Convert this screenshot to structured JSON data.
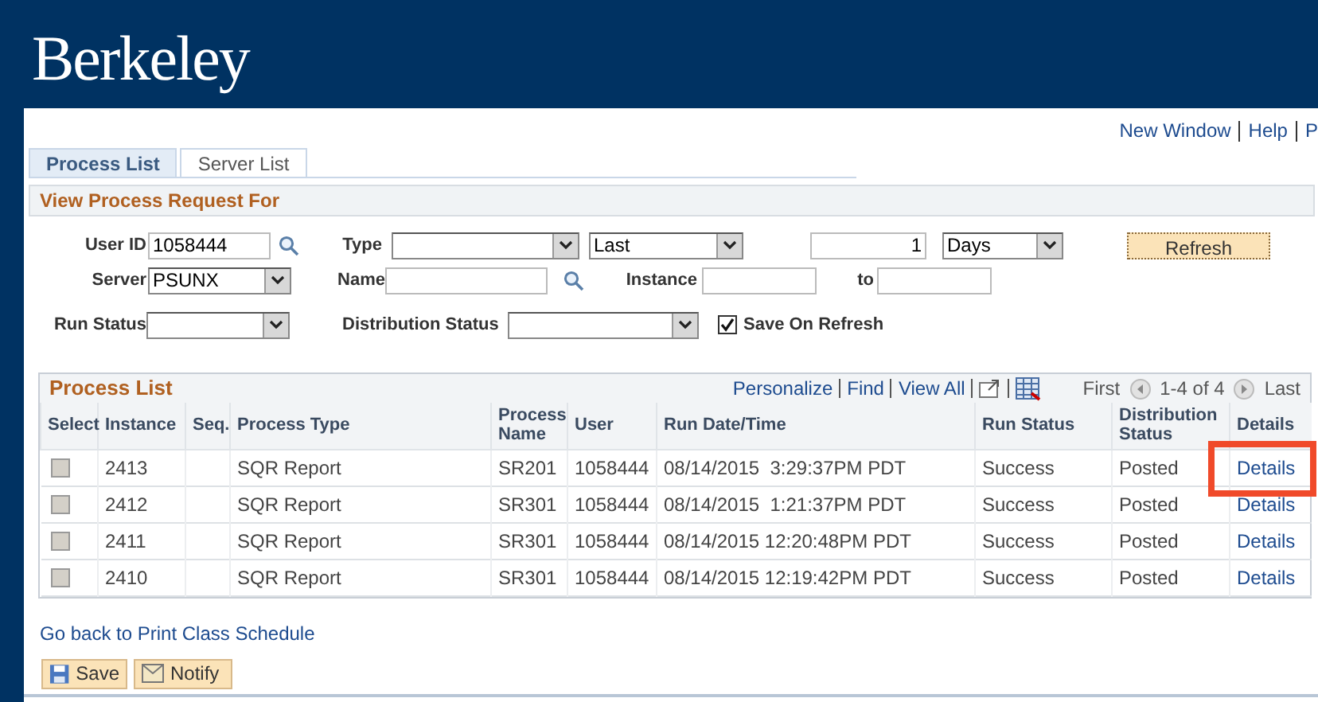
{
  "header": {
    "logo": "Berkeley"
  },
  "top_links": [
    "New Window",
    "Help",
    "P"
  ],
  "tabs": [
    {
      "label": "Process List",
      "selected": true
    },
    {
      "label": "Server List",
      "selected": false
    }
  ],
  "filter": {
    "title": "View Process Request For",
    "user_id": {
      "label": "User ID",
      "value": "1058444"
    },
    "type": {
      "label": "Type"
    },
    "last": {
      "value": "Last"
    },
    "count": {
      "value": "1"
    },
    "unit": {
      "value": "Days"
    },
    "refresh": "Refresh",
    "server": {
      "label": "Server",
      "value": "PSUNX"
    },
    "name": {
      "label": "Name"
    },
    "instance": {
      "label": "Instance"
    },
    "to": {
      "label": "to"
    },
    "run_status": {
      "label": "Run Status"
    },
    "distribution_status": {
      "label": "Distribution Status"
    },
    "save_on_refresh": {
      "label": "Save On Refresh",
      "checked": true
    }
  },
  "process_list": {
    "title": "Process List",
    "tools": [
      "Personalize",
      "Find",
      "View All"
    ],
    "nav": {
      "first": "First",
      "range": "1-4 of 4",
      "last": "Last"
    },
    "columns": [
      "Select",
      "Instance",
      "Seq.",
      "Process Type",
      "Process Name",
      "User",
      "Run Date/Time",
      "Run Status",
      "Distribution Status",
      "Details"
    ],
    "rows": [
      {
        "checked": false,
        "instance": "2413",
        "seq": "",
        "type": "SQR Report",
        "name": "SR201",
        "user": "1058444",
        "run": "08/14/2015  3:29:37PM PDT",
        "status": "Success",
        "dist": "Posted",
        "details": "Details",
        "highlighted": true
      },
      {
        "checked": false,
        "instance": "2412",
        "seq": "",
        "type": "SQR Report",
        "name": "SR301",
        "user": "1058444",
        "run": "08/14/2015  1:21:37PM PDT",
        "status": "Success",
        "dist": "Posted",
        "details": "Details",
        "highlighted": false
      },
      {
        "checked": false,
        "instance": "2411",
        "seq": "",
        "type": "SQR Report",
        "name": "SR301",
        "user": "1058444",
        "run": "08/14/2015 12:20:48PM PDT",
        "status": "Success",
        "dist": "Posted",
        "details": "Details",
        "highlighted": false
      },
      {
        "checked": false,
        "instance": "2410",
        "seq": "",
        "type": "SQR Report",
        "name": "SR301",
        "user": "1058444",
        "run": "08/14/2015 12:19:42PM PDT",
        "status": "Success",
        "dist": "Posted",
        "details": "Details",
        "highlighted": false
      }
    ]
  },
  "back_link": "Go back to Print Class Schedule",
  "buttons": [
    "Save",
    "Notify"
  ]
}
